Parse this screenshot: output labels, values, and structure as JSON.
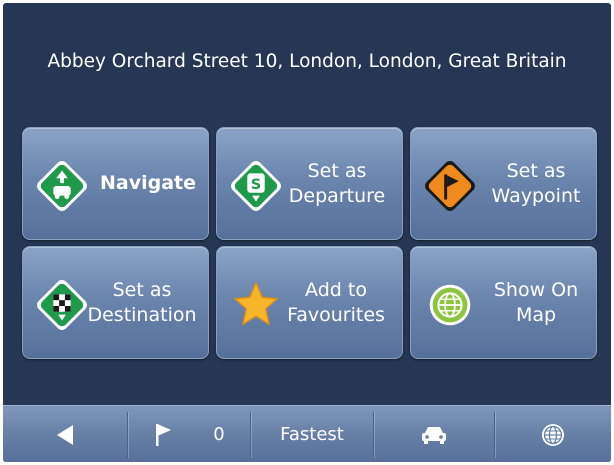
{
  "address": "Abbey Orchard Street 10, London, London, Great Britain",
  "actions": {
    "navigate": "Navigate",
    "set_departure": "Set as\nDeparture",
    "set_waypoint": "Set as\nWaypoint",
    "set_destination": "Set as\nDestination",
    "add_favourites": "Add to\nFavourites",
    "show_on_map": "Show On\nMap"
  },
  "bottom_bar": {
    "waypoint_count": "0",
    "route_mode": "Fastest"
  },
  "icons": {
    "navigate": "car-sign-icon",
    "departure": "start-sign-icon",
    "waypoint": "flag-sign-icon",
    "destination": "checkered-flag-sign-icon",
    "favourites": "star-icon",
    "map": "globe-icon",
    "back": "back-arrow-icon",
    "flag": "flag-icon",
    "vehicle": "car-icon"
  },
  "colors": {
    "background": "#253754",
    "tile": "#6b86ad",
    "green_sign": "#1f9a4a",
    "orange_sign": "#f08a1c",
    "star": "#f7b52a"
  }
}
